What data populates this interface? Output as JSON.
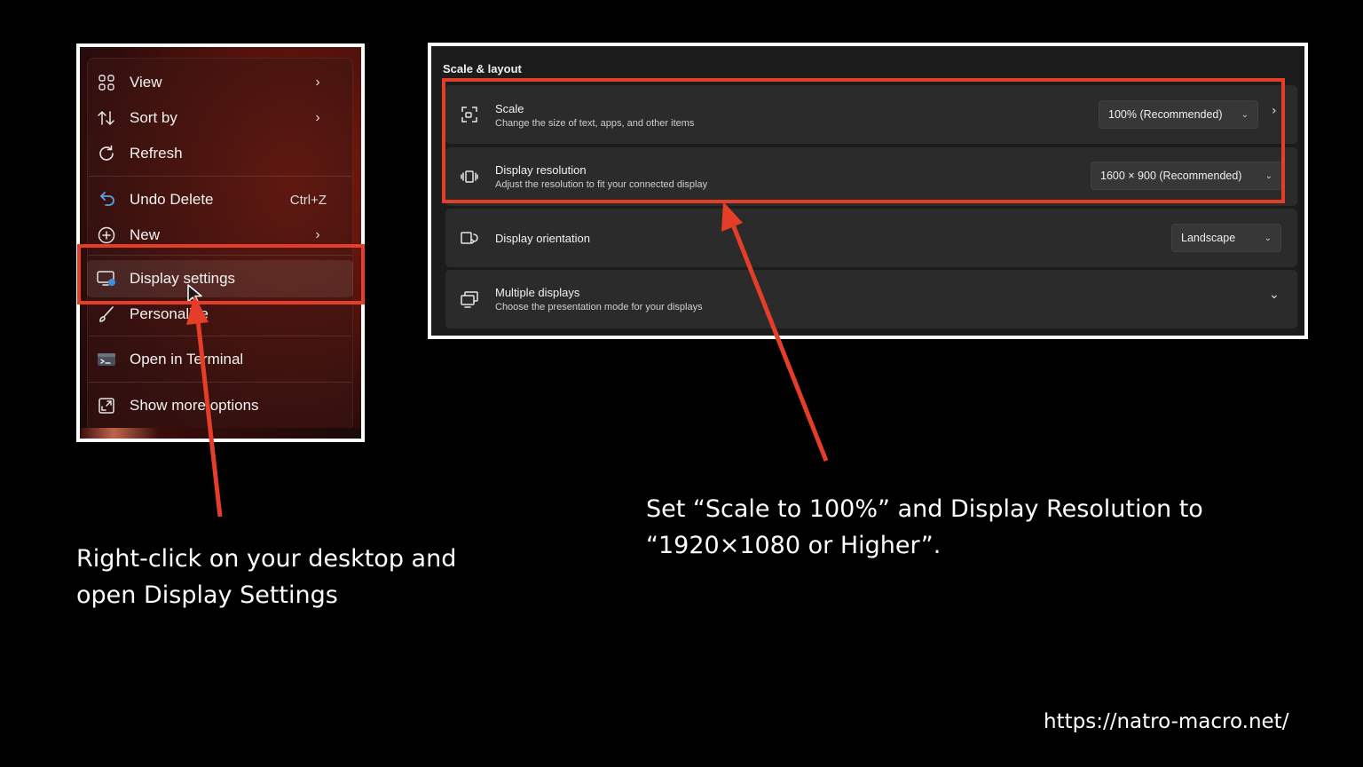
{
  "context_menu": {
    "items": [
      {
        "label": "View",
        "icon": "grid-icon",
        "arrow": "›"
      },
      {
        "label": "Sort by",
        "icon": "sort-arrows-icon",
        "arrow": "›"
      },
      {
        "label": "Refresh",
        "icon": "refresh-icon"
      },
      {
        "label": "Undo Delete",
        "icon": "undo-icon",
        "shortcut": "Ctrl+Z"
      },
      {
        "label": "New",
        "icon": "plus-circle-icon",
        "arrow": "›"
      },
      {
        "label": "Display settings",
        "icon": "display-settings-icon"
      },
      {
        "label": "Personalize",
        "icon": "brush-icon"
      },
      {
        "label": "Open in Terminal",
        "icon": "terminal-icon"
      },
      {
        "label": "Show more options",
        "icon": "expand-icon"
      }
    ]
  },
  "settings": {
    "section_title": "Scale & layout",
    "scale": {
      "title": "Scale",
      "description": "Change the size of text, apps, and other items",
      "value": "100% (Recommended)",
      "icon": "scale-icon"
    },
    "resolution": {
      "title": "Display resolution",
      "description": "Adjust the resolution to fit your connected display",
      "value": "1600 × 900 (Recommended)",
      "icon": "resolution-icon"
    },
    "orientation": {
      "title": "Display orientation",
      "value": "Landscape",
      "icon": "orientation-icon"
    },
    "multiple": {
      "title": "Multiple displays",
      "description": "Choose the presentation mode for your displays",
      "icon": "multiple-displays-icon"
    }
  },
  "captions": {
    "left_line1": "Right-click on your desktop and",
    "left_line2": "open Display Settings",
    "right_line1": "Set “Scale to 100%” and Display Resolution to",
    "right_line2": "“1920×1080 or Higher”."
  },
  "footer": {
    "url": "https://natro-macro.net/"
  },
  "colors": {
    "highlight": "#e43d28",
    "background": "#000000",
    "card": "#2b2b2b"
  }
}
